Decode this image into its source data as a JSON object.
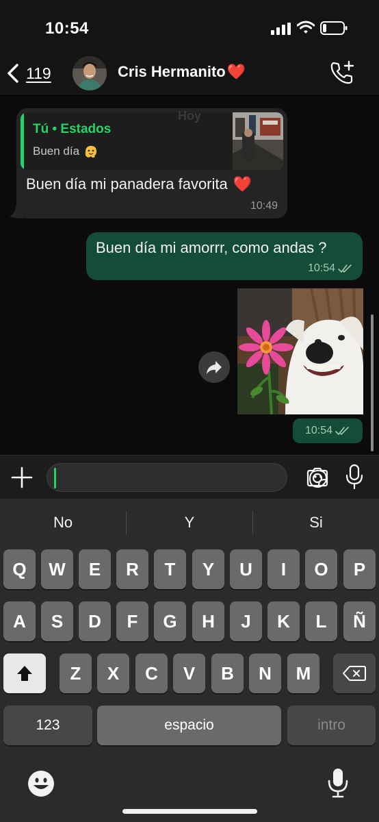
{
  "status_bar": {
    "time": "10:54",
    "icons": [
      "signal-icon",
      "wifi-icon",
      "battery-icon"
    ]
  },
  "header": {
    "back_icon": "chevron-left-icon",
    "unread_count": "119",
    "contact_name": "Cris Hermanito",
    "name_emoji": "❤️",
    "call_icon": "add-call-icon"
  },
  "chat": {
    "date_label": "Hoy",
    "messages": [
      {
        "direction": "incoming",
        "quote_author": "Tú • Estados",
        "quote_text": "Buen día",
        "quote_emoji_icon": "melting-face-icon",
        "text": "Buen día mi panadera favorita",
        "text_emoji": "❤️",
        "time": "10:49"
      },
      {
        "direction": "outgoing",
        "text": "Buen día mi amorrr, como andas ?",
        "time": "10:54",
        "status_icon": "double-check-icon"
      },
      {
        "direction": "outgoing",
        "type": "sticker",
        "sticker_icon": "smiling-dog-with-flower-sticker",
        "time": "10:54",
        "status_icon": "double-check-icon"
      }
    ],
    "forward_icon": "forward-icon"
  },
  "input_bar": {
    "plus_icon": "plus-icon",
    "message_value": "",
    "sticker_icon": "sticker-icon",
    "camera_icon": "camera-icon",
    "mic_icon": "microphone-icon"
  },
  "keyboard": {
    "suggestions": [
      "No",
      "Y",
      "Si"
    ],
    "row1": [
      "Q",
      "W",
      "E",
      "R",
      "T",
      "Y",
      "U",
      "I",
      "O",
      "P"
    ],
    "row2": [
      "A",
      "S",
      "D",
      "F",
      "G",
      "H",
      "J",
      "K",
      "L",
      "Ñ"
    ],
    "row3": [
      "Z",
      "X",
      "C",
      "V",
      "B",
      "N",
      "M"
    ],
    "shift_icon": "shift-icon",
    "delete_icon": "delete-icon",
    "numbers_label": "123",
    "space_label": "espacio",
    "return_label": "intro",
    "emoji_icon": "emoji-icon",
    "dictation_icon": "dictation-mic-icon"
  },
  "colors": {
    "accent_green": "#25d366",
    "outgoing_bubble": "#144d37",
    "incoming_bubble": "#242424",
    "keyboard_bg": "#2b2b2b"
  }
}
